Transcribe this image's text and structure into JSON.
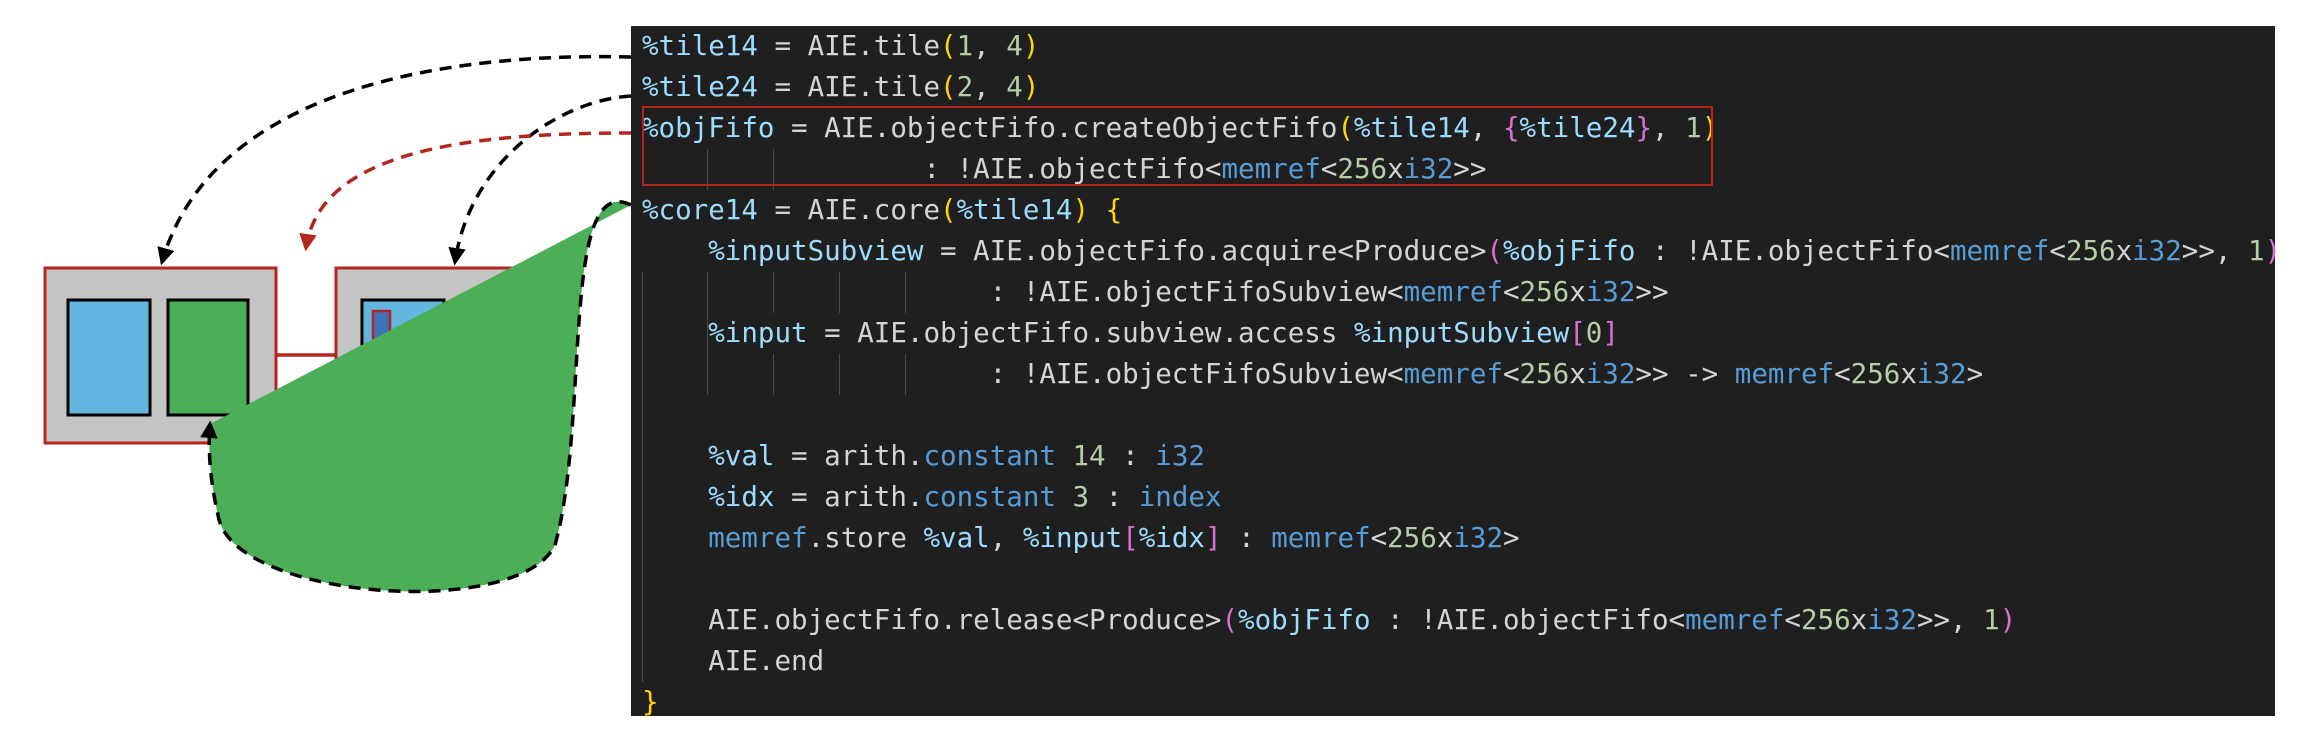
{
  "colors": {
    "tile_border": "#b3261e",
    "tile_fill": "#c4c4c4",
    "memory_fill": "#64b5e0",
    "core_fill": "#4caf58",
    "code_background": "#1f1f1f",
    "highlight_border": "#b3261e"
  },
  "diagram": {
    "tiles": [
      {
        "id": "tile14",
        "buffer_marked": false
      },
      {
        "id": "tile24",
        "buffer_marked": true
      }
    ],
    "arrows": [
      {
        "from": "code-line-tile14",
        "to": "tile14",
        "style": "black-dashed"
      },
      {
        "from": "code-line-tile24",
        "to": "tile24",
        "style": "black-dashed"
      },
      {
        "from": "code-objfifo-highlight",
        "to": "tile-link",
        "style": "red-dashed"
      },
      {
        "from": "code-line-core14",
        "to": "tile14-core",
        "style": "black-dashed"
      }
    ]
  },
  "code": {
    "lines": [
      [
        [
          "v",
          "%tile14"
        ],
        [
          "w",
          " = AIE.tile"
        ],
        [
          "b1",
          "("
        ],
        [
          "n",
          "1"
        ],
        [
          "w",
          ", "
        ],
        [
          "n",
          "4"
        ],
        [
          "b1",
          ")"
        ]
      ],
      [
        [
          "v",
          "%tile24"
        ],
        [
          "w",
          " = AIE.tile"
        ],
        [
          "b1",
          "("
        ],
        [
          "n",
          "2"
        ],
        [
          "w",
          ", "
        ],
        [
          "n",
          "4"
        ],
        [
          "b1",
          ")"
        ]
      ],
      [
        [
          "v",
          "%objFifo"
        ],
        [
          "w",
          " = AIE.objectFifo.createObjectFifo"
        ],
        [
          "b1",
          "("
        ],
        [
          "v",
          "%tile14"
        ],
        [
          "w",
          ", "
        ],
        [
          "b2",
          "{"
        ],
        [
          "v",
          "%tile24"
        ],
        [
          "b2",
          "}"
        ],
        [
          "w",
          ", "
        ],
        [
          "n",
          "1"
        ],
        [
          "b1",
          ")"
        ]
      ],
      [
        [
          "w",
          "                 : !AIE.objectFifo<"
        ],
        [
          "t",
          "memref"
        ],
        [
          "w",
          "<"
        ],
        [
          "n",
          "256"
        ],
        [
          "w",
          "x"
        ],
        [
          "t",
          "i32"
        ],
        [
          "w",
          ">>"
        ]
      ],
      [
        [
          "v",
          "%core14"
        ],
        [
          "w",
          " = AIE.core"
        ],
        [
          "b1",
          "("
        ],
        [
          "v",
          "%tile14"
        ],
        [
          "b1",
          ")"
        ],
        [
          "w",
          " "
        ],
        [
          "b1",
          "{"
        ]
      ],
      [
        [
          "w",
          "    "
        ],
        [
          "v",
          "%inputSubview"
        ],
        [
          "w",
          " = AIE.objectFifo.acquire<Produce>"
        ],
        [
          "b2",
          "("
        ],
        [
          "v",
          "%objFifo"
        ],
        [
          "w",
          " : !AIE.objectFifo<"
        ],
        [
          "t",
          "memref"
        ],
        [
          "w",
          "<"
        ],
        [
          "n",
          "256"
        ],
        [
          "w",
          "x"
        ],
        [
          "t",
          "i32"
        ],
        [
          "w",
          ">>, "
        ],
        [
          "n",
          "1"
        ],
        [
          "b2",
          ")"
        ]
      ],
      [
        [
          "w",
          "                     : !AIE.objectFifoSubview<"
        ],
        [
          "t",
          "memref"
        ],
        [
          "w",
          "<"
        ],
        [
          "n",
          "256"
        ],
        [
          "w",
          "x"
        ],
        [
          "t",
          "i32"
        ],
        [
          "w",
          ">>"
        ]
      ],
      [
        [
          "w",
          "    "
        ],
        [
          "v",
          "%input"
        ],
        [
          "w",
          " = AIE.objectFifo.subview.access "
        ],
        [
          "v",
          "%inputSubview"
        ],
        [
          "b2",
          "["
        ],
        [
          "n",
          "0"
        ],
        [
          "b2",
          "]"
        ]
      ],
      [
        [
          "w",
          "                     : !AIE.objectFifoSubview<"
        ],
        [
          "t",
          "memref"
        ],
        [
          "w",
          "<"
        ],
        [
          "n",
          "256"
        ],
        [
          "w",
          "x"
        ],
        [
          "t",
          "i32"
        ],
        [
          "w",
          ">> -> "
        ],
        [
          "t",
          "memref"
        ],
        [
          "w",
          "<"
        ],
        [
          "n",
          "256"
        ],
        [
          "w",
          "x"
        ],
        [
          "t",
          "i32"
        ],
        [
          "w",
          ">"
        ]
      ],
      [],
      [
        [
          "w",
          "    "
        ],
        [
          "v",
          "%val"
        ],
        [
          "w",
          " = arith."
        ],
        [
          "t",
          "constant"
        ],
        [
          "w",
          " "
        ],
        [
          "n",
          "14"
        ],
        [
          "w",
          " : "
        ],
        [
          "t",
          "i32"
        ]
      ],
      [
        [
          "w",
          "    "
        ],
        [
          "v",
          "%idx"
        ],
        [
          "w",
          " = arith."
        ],
        [
          "t",
          "constant"
        ],
        [
          "w",
          " "
        ],
        [
          "n",
          "3"
        ],
        [
          "w",
          " : "
        ],
        [
          "t",
          "index"
        ]
      ],
      [
        [
          "w",
          "    "
        ],
        [
          "t",
          "memref"
        ],
        [
          "w",
          ".store "
        ],
        [
          "v",
          "%val"
        ],
        [
          "w",
          ", "
        ],
        [
          "v",
          "%input"
        ],
        [
          "b2",
          "["
        ],
        [
          "v",
          "%idx"
        ],
        [
          "b2",
          "]"
        ],
        [
          "w",
          " : "
        ],
        [
          "t",
          "memref"
        ],
        [
          "w",
          "<"
        ],
        [
          "n",
          "256"
        ],
        [
          "w",
          "x"
        ],
        [
          "t",
          "i32"
        ],
        [
          "w",
          ">"
        ]
      ],
      [],
      [
        [
          "w",
          "    AIE.objectFifo.release<Produce>"
        ],
        [
          "b2",
          "("
        ],
        [
          "v",
          "%objFifo"
        ],
        [
          "w",
          " : !AIE.objectFifo<"
        ],
        [
          "t",
          "memref"
        ],
        [
          "w",
          "<"
        ],
        [
          "n",
          "256"
        ],
        [
          "w",
          "x"
        ],
        [
          "t",
          "i32"
        ],
        [
          "w",
          ">>, "
        ],
        [
          "n",
          "1"
        ],
        [
          "b2",
          ")"
        ]
      ],
      [
        [
          "w",
          "    AIE.end"
        ]
      ],
      [
        [
          "b1",
          "}"
        ]
      ]
    ]
  }
}
